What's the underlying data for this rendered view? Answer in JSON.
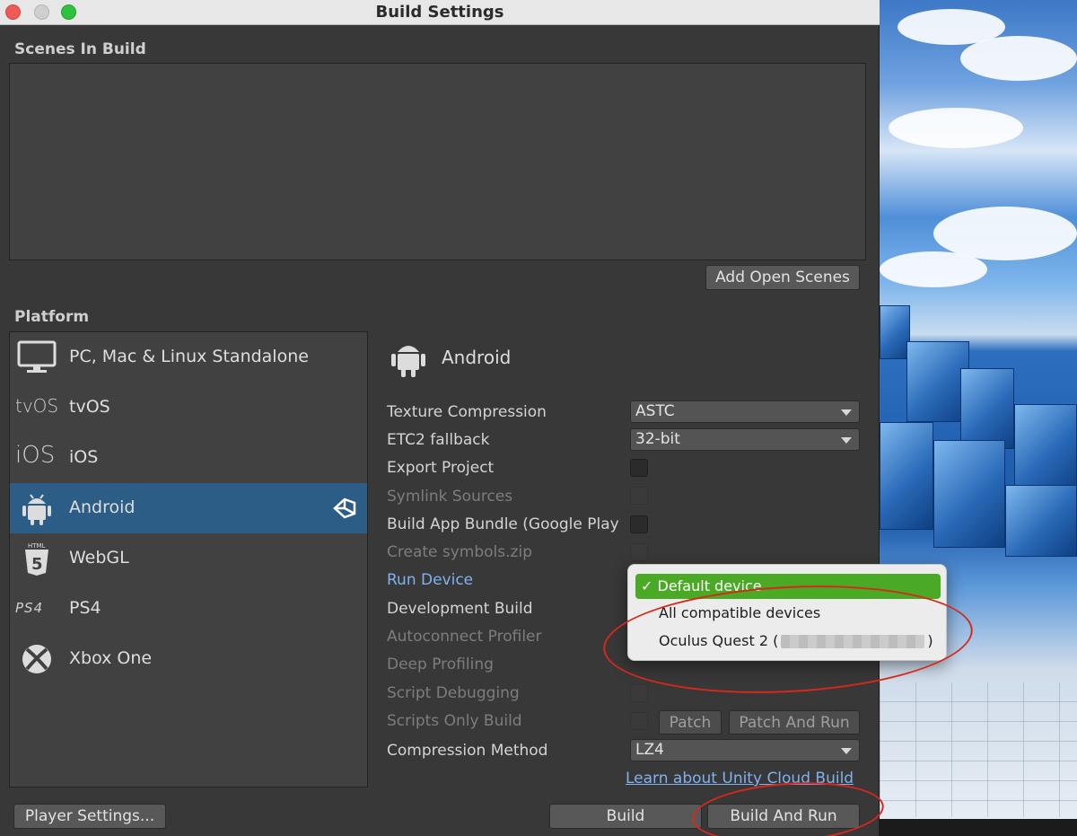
{
  "window": {
    "title": "Build Settings"
  },
  "scenes": {
    "label": "Scenes In Build",
    "add_open_scenes": "Add Open Scenes"
  },
  "platform": {
    "label": "Platform",
    "items": [
      {
        "label": "PC, Mac & Linux Standalone",
        "icon": "monitor-icon"
      },
      {
        "label": "tvOS",
        "icon_text": "tvOS"
      },
      {
        "label": "iOS",
        "icon_text": "iOS"
      },
      {
        "label": "Android",
        "icon": "android-icon",
        "selected": true
      },
      {
        "label": "WebGL",
        "icon": "html5-icon"
      },
      {
        "label": "PS4",
        "icon_text": "PS4"
      },
      {
        "label": "Xbox One",
        "icon": "xbox-icon"
      }
    ]
  },
  "selected_platform": {
    "title": "Android"
  },
  "settings": {
    "texture_compression": {
      "label": "Texture Compression",
      "value": "ASTC"
    },
    "etc2_fallback": {
      "label": "ETC2 fallback",
      "value": "32-bit"
    },
    "export_project": {
      "label": "Export Project"
    },
    "symlink_sources": {
      "label": "Symlink Sources"
    },
    "build_app_bundle": {
      "label": "Build App Bundle (Google Play"
    },
    "create_symbols": {
      "label": "Create symbols.zip"
    },
    "run_device": {
      "label": "Run Device"
    },
    "development_build": {
      "label": "Development Build"
    },
    "autoconnect_profiler": {
      "label": "Autoconnect Profiler"
    },
    "deep_profiling": {
      "label": "Deep Profiling"
    },
    "script_debugging": {
      "label": "Script Debugging"
    },
    "scripts_only_build": {
      "label": "Scripts Only Build",
      "patch": "Patch",
      "patch_and_run": "Patch And Run"
    },
    "compression_method": {
      "label": "Compression Method",
      "value": "LZ4"
    },
    "learn_link": "Learn about Unity Cloud Build"
  },
  "run_device_menu": {
    "check": "✓",
    "items": [
      "Default device",
      "All compatible devices"
    ],
    "device_prefix": "Oculus Quest 2 (",
    "device_suffix": ")"
  },
  "footer": {
    "player_settings": "Player Settings...",
    "build": "Build",
    "build_and_run": "Build And Run"
  },
  "colors": {
    "accent_selected": "#2c5d87",
    "menu_active": "#4aa925",
    "annotation": "#d8281c",
    "link": "#7fb2ef"
  }
}
